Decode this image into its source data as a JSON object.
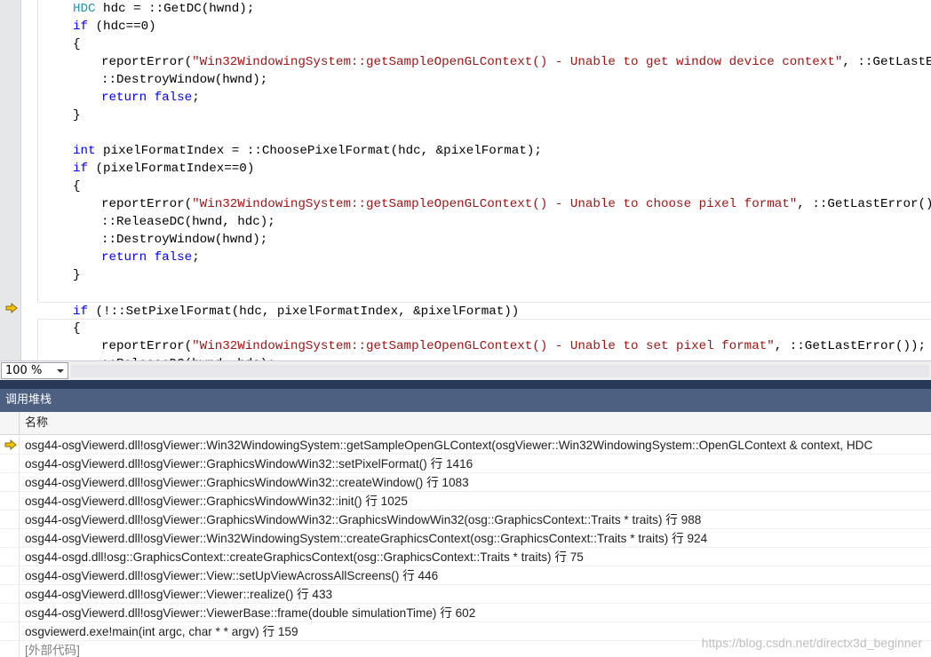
{
  "editor": {
    "lines": [
      {
        "indent": 2,
        "tokens": [
          {
            "t": "type",
            "v": "HDC"
          },
          {
            "t": "def",
            "v": " hdc = ::GetDC(hwnd);"
          }
        ]
      },
      {
        "indent": 2,
        "tokens": [
          {
            "t": "kw",
            "v": "if"
          },
          {
            "t": "def",
            "v": " (hdc==0)"
          }
        ]
      },
      {
        "indent": 2,
        "tokens": [
          {
            "t": "def",
            "v": "{"
          }
        ]
      },
      {
        "indent": 3,
        "tokens": [
          {
            "t": "def",
            "v": "reportError("
          },
          {
            "t": "str",
            "v": "\"Win32WindowingSystem::getSampleOpenGLContext() - Unable to get window device context\""
          },
          {
            "t": "def",
            "v": ", ::GetLastError());"
          }
        ]
      },
      {
        "indent": 3,
        "tokens": [
          {
            "t": "def",
            "v": "::DestroyWindow(hwnd);"
          }
        ]
      },
      {
        "indent": 3,
        "tokens": [
          {
            "t": "kw",
            "v": "return"
          },
          {
            "t": "def",
            "v": " "
          },
          {
            "t": "kw",
            "v": "false"
          },
          {
            "t": "def",
            "v": ";"
          }
        ]
      },
      {
        "indent": 2,
        "tokens": [
          {
            "t": "def",
            "v": "}"
          }
        ]
      },
      {
        "indent": 2,
        "tokens": []
      },
      {
        "indent": 2,
        "tokens": [
          {
            "t": "kw",
            "v": "int"
          },
          {
            "t": "def",
            "v": " pixelFormatIndex = ::ChoosePixelFormat(hdc, &pixelFormat);"
          }
        ]
      },
      {
        "indent": 2,
        "tokens": [
          {
            "t": "kw",
            "v": "if"
          },
          {
            "t": "def",
            "v": " (pixelFormatIndex==0)"
          }
        ]
      },
      {
        "indent": 2,
        "tokens": [
          {
            "t": "def",
            "v": "{"
          }
        ]
      },
      {
        "indent": 3,
        "tokens": [
          {
            "t": "def",
            "v": "reportError("
          },
          {
            "t": "str",
            "v": "\"Win32WindowingSystem::getSampleOpenGLContext() - Unable to choose pixel format\""
          },
          {
            "t": "def",
            "v": ", ::GetLastError());"
          }
        ]
      },
      {
        "indent": 3,
        "tokens": [
          {
            "t": "def",
            "v": "::ReleaseDC(hwnd, hdc);"
          }
        ]
      },
      {
        "indent": 3,
        "tokens": [
          {
            "t": "def",
            "v": "::DestroyWindow(hwnd);"
          }
        ]
      },
      {
        "indent": 3,
        "tokens": [
          {
            "t": "kw",
            "v": "return"
          },
          {
            "t": "def",
            "v": " "
          },
          {
            "t": "kw",
            "v": "false"
          },
          {
            "t": "def",
            "v": ";"
          }
        ]
      },
      {
        "indent": 2,
        "tokens": [
          {
            "t": "def",
            "v": "}"
          }
        ]
      },
      {
        "indent": 2,
        "tokens": []
      },
      {
        "indent": 2,
        "current": true,
        "tokens": [
          {
            "t": "kw",
            "v": "if"
          },
          {
            "t": "def",
            "v": " (!::SetPixelFormat(hdc, pixelFormatIndex, &pixelFormat))"
          }
        ]
      },
      {
        "indent": 2,
        "tokens": [
          {
            "t": "def",
            "v": "{"
          }
        ]
      },
      {
        "indent": 3,
        "tokens": [
          {
            "t": "def",
            "v": "reportError("
          },
          {
            "t": "str",
            "v": "\"Win32WindowingSystem::getSampleOpenGLContext() - Unable to set pixel format\""
          },
          {
            "t": "def",
            "v": ", ::GetLastError());"
          }
        ]
      },
      {
        "indent": 3,
        "tokens": [
          {
            "t": "def",
            "v": "::ReleaseDC(hwnd, hdc);"
          }
        ]
      }
    ]
  },
  "zoom": {
    "value": "100 %"
  },
  "call_stack": {
    "title": "调用堆栈",
    "column_name": "名称",
    "rows": [
      {
        "text": "osg44-osgViewerd.dll!osgViewer::Win32WindowingSystem::getSampleOpenGLContext(osgViewer::Win32WindowingSystem::OpenGLContext & context, HDC",
        "current": true
      },
      {
        "text": "osg44-osgViewerd.dll!osgViewer::GraphicsWindowWin32::setPixelFormat() 行 1416"
      },
      {
        "text": "osg44-osgViewerd.dll!osgViewer::GraphicsWindowWin32::createWindow() 行 1083"
      },
      {
        "text": "osg44-osgViewerd.dll!osgViewer::GraphicsWindowWin32::init() 行 1025"
      },
      {
        "text": "osg44-osgViewerd.dll!osgViewer::GraphicsWindowWin32::GraphicsWindowWin32(osg::GraphicsContext::Traits * traits) 行 988"
      },
      {
        "text": "osg44-osgViewerd.dll!osgViewer::Win32WindowingSystem::createGraphicsContext(osg::GraphicsContext::Traits * traits) 行 924"
      },
      {
        "text": "osg44-osgd.dll!osg::GraphicsContext::createGraphicsContext(osg::GraphicsContext::Traits * traits) 行 75"
      },
      {
        "text": "osg44-osgViewerd.dll!osgViewer::View::setUpViewAcrossAllScreens() 行 446"
      },
      {
        "text": "osg44-osgViewerd.dll!osgViewer::Viewer::realize() 行 433"
      },
      {
        "text": "osg44-osgViewerd.dll!osgViewer::ViewerBase::frame(double simulationTime) 行 602"
      },
      {
        "text": "osgviewerd.exe!main(int argc, char * * argv) 行 159"
      },
      {
        "text": "[外部代码]",
        "external": true
      }
    ]
  },
  "watermark": "https://blog.csdn.net/directx3d_beginner",
  "colors": {
    "keyword": "#0000ff",
    "type": "#2b91af",
    "string": "#a31515",
    "arrow": "#f2c40f",
    "panel_title": "#4d6082"
  },
  "icons": {
    "current_statement": "yellow-arrow-icon",
    "dropdown": "chevron-down-icon"
  }
}
